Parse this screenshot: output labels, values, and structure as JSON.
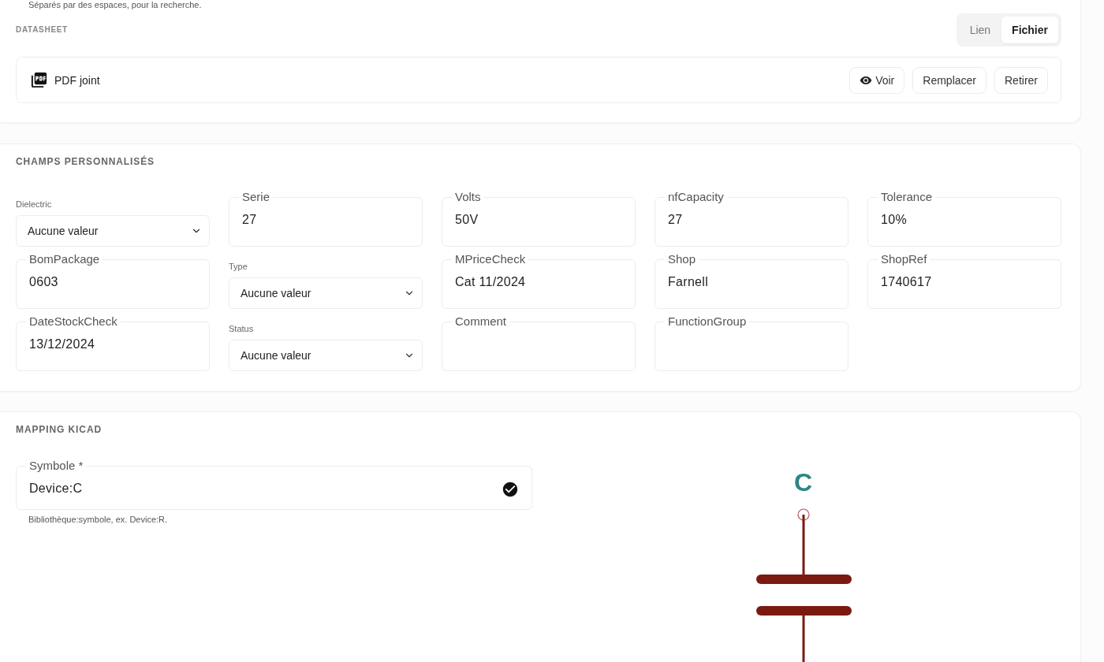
{
  "tags_hint": "Séparés par des espaces, pour la recherche.",
  "datasheet": {
    "title": "DATASHEET",
    "source_tabs": [
      {
        "label": "Lien",
        "selected": false
      },
      {
        "label": "Fichier",
        "selected": true
      }
    ],
    "file": {
      "name": "PDF joint",
      "actions": [
        {
          "label": "Voir",
          "kind": "view"
        },
        {
          "label": "Remplacer",
          "kind": "plain"
        },
        {
          "label": "Retirer",
          "kind": "plain"
        }
      ]
    }
  },
  "custom_fields": {
    "title": "CHAMPS PERSONNALISÉS",
    "fields": [
      {
        "kind": "select",
        "label": "Dielectric",
        "value": "Aucune valeur"
      },
      {
        "kind": "text",
        "label": "Serie",
        "value": "27"
      },
      {
        "kind": "text",
        "label": "Volts",
        "value": "50V"
      },
      {
        "kind": "text",
        "label": "nfCapacity",
        "value": "27"
      },
      {
        "kind": "text",
        "label": "Tolerance",
        "value": "10%"
      },
      {
        "kind": "text",
        "label": "BomPackage",
        "value": "0603"
      },
      {
        "kind": "select",
        "label": "Type",
        "value": "Aucune valeur"
      },
      {
        "kind": "text",
        "label": "MPriceCheck",
        "value": "Cat 11/2024"
      },
      {
        "kind": "text",
        "label": "Shop",
        "value": "Farnell"
      },
      {
        "kind": "text",
        "label": "ShopRef",
        "value": "1740617"
      },
      {
        "kind": "text",
        "label": "DateStockCheck",
        "value": "13/12/2024"
      },
      {
        "kind": "select",
        "label": "Status",
        "value": "Aucune valeur"
      },
      {
        "kind": "text",
        "label": "Comment"
      },
      {
        "kind": "text",
        "label": "FunctionGroup"
      }
    ]
  },
  "kicad_mapping": {
    "title": "MAPPING KICAD",
    "symbol_field": {
      "label": "Symbole *",
      "value": "Device:C",
      "valid": true,
      "hint": "Bibliothèque:symbole, ex. Device:R."
    },
    "symbol_preview": {
      "reference": "C"
    }
  }
}
